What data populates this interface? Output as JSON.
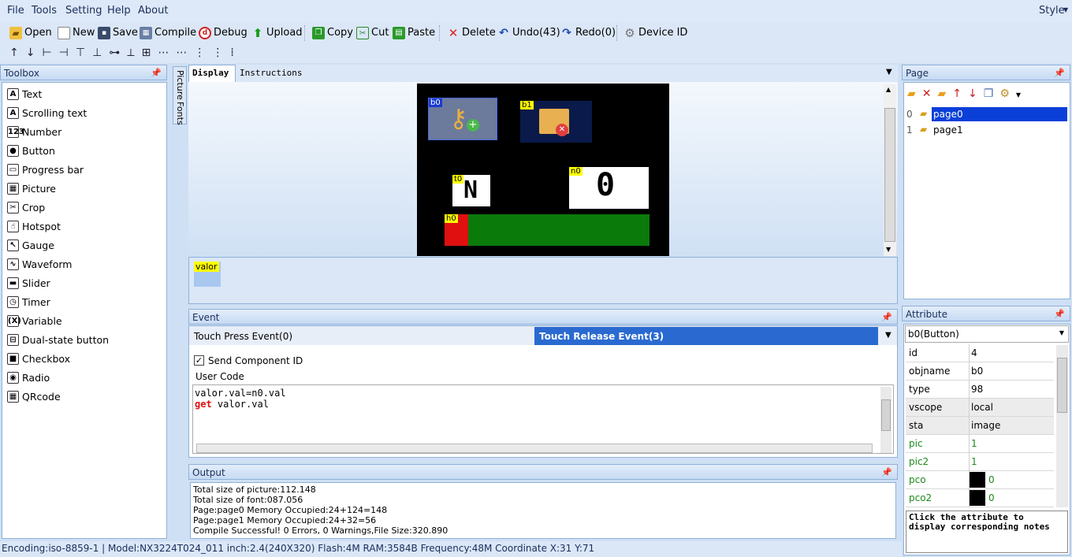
{
  "menu": {
    "file": "File",
    "tools": "Tools",
    "setting": "Setting",
    "help": "Help",
    "about": "About",
    "style": "Style"
  },
  "toolbar": {
    "open": "Open",
    "new": "New",
    "save": "Save",
    "compile": "Compile",
    "debug": "Debug",
    "upload": "Upload",
    "copy": "Copy",
    "cut": "Cut",
    "paste": "Paste",
    "delete": "Delete",
    "undo": "Undo(43)",
    "redo": "Redo(0)",
    "device_id": "Device  ID"
  },
  "toolbox": {
    "title": "Toolbox",
    "items": [
      "Text",
      "Scrolling text",
      "Number",
      "Button",
      "Progress bar",
      "Picture",
      "Crop",
      "Hotspot",
      "Gauge",
      "Waveform",
      "Slider",
      "Timer",
      "Variable",
      "Dual-state button",
      "Checkbox",
      "Radio",
      "QRcode"
    ],
    "icons": [
      "text-icon",
      "scrolling-text-icon",
      "number-icon",
      "button-icon",
      "progress-bar-icon",
      "picture-icon",
      "crop-icon",
      "hotspot-icon",
      "gauge-icon",
      "waveform-icon",
      "slider-icon",
      "timer-icon",
      "variable-icon",
      "dual-state-button-icon",
      "checkbox-icon",
      "radio-icon",
      "qrcode-icon"
    ],
    "glyphs": [
      "A",
      "A",
      "123",
      "●",
      "▭",
      "▦",
      "✂",
      "☝",
      "↖",
      "∿",
      "▬",
      "◷",
      "(X)",
      "⊟",
      "■",
      "◉",
      "▦"
    ]
  },
  "side_tabs": {
    "picture": "Picture",
    "fonts": "Fonts"
  },
  "display_tabs": {
    "display": "Display",
    "instructions": "Instructions"
  },
  "canvas": {
    "b0": "b0",
    "b1": "b1",
    "t0": "t0",
    "t0_value": "N",
    "n0": "n0",
    "n0_value": "0",
    "h0": "h0",
    "progress_value": 0.1
  },
  "variables": {
    "valor": "valor"
  },
  "event": {
    "title": "Event",
    "touch_press": "Touch Press Event(0)",
    "touch_release": "Touch Release Event(3)",
    "send_id": "Send Component ID",
    "user_code_label": "User Code",
    "code_line1": "valor.val=n0.val",
    "code_kw": "get",
    "code_line2_rest": " valor.val"
  },
  "output": {
    "title": "Output",
    "lines": [
      "Total size of picture:112.148",
      "Total size of font:087.056",
      "Page:page0 Memory Occupied:24+124=148",
      "Page:page1 Memory Occupied:24+32=56",
      "Compile Successful! 0 Errors, 0 Warnings,File Size:320.890"
    ]
  },
  "page": {
    "title": "Page",
    "items": [
      {
        "index": "0",
        "name": "page0"
      },
      {
        "index": "1",
        "name": "page1"
      }
    ]
  },
  "attribute": {
    "title": "Attribute",
    "selected": "b0(Button)",
    "rows": [
      [
        "id",
        "4"
      ],
      [
        "objname",
        "b0"
      ],
      [
        "type",
        "98"
      ],
      [
        "vscope",
        "local"
      ],
      [
        "sta",
        "image"
      ],
      [
        "pic",
        "1"
      ],
      [
        "pic2",
        "1"
      ],
      [
        "pco",
        "0"
      ],
      [
        "pco2",
        "0"
      ]
    ],
    "note": "Click the attribute to display corresponding notes"
  },
  "status": "Encoding:iso-8859-1 | Model:NX3224T024_011  inch:2.4(240X320) Flash:4M RAM:3584B Frequency:48M    Coordinate X:31  Y:71",
  "colors": {
    "accent": "#0a3fd8",
    "canvas_bg": "#000000",
    "progress_fill": "#e01010",
    "progress_bg": "#0a7a0a",
    "tag_bg": "#ffff00"
  }
}
